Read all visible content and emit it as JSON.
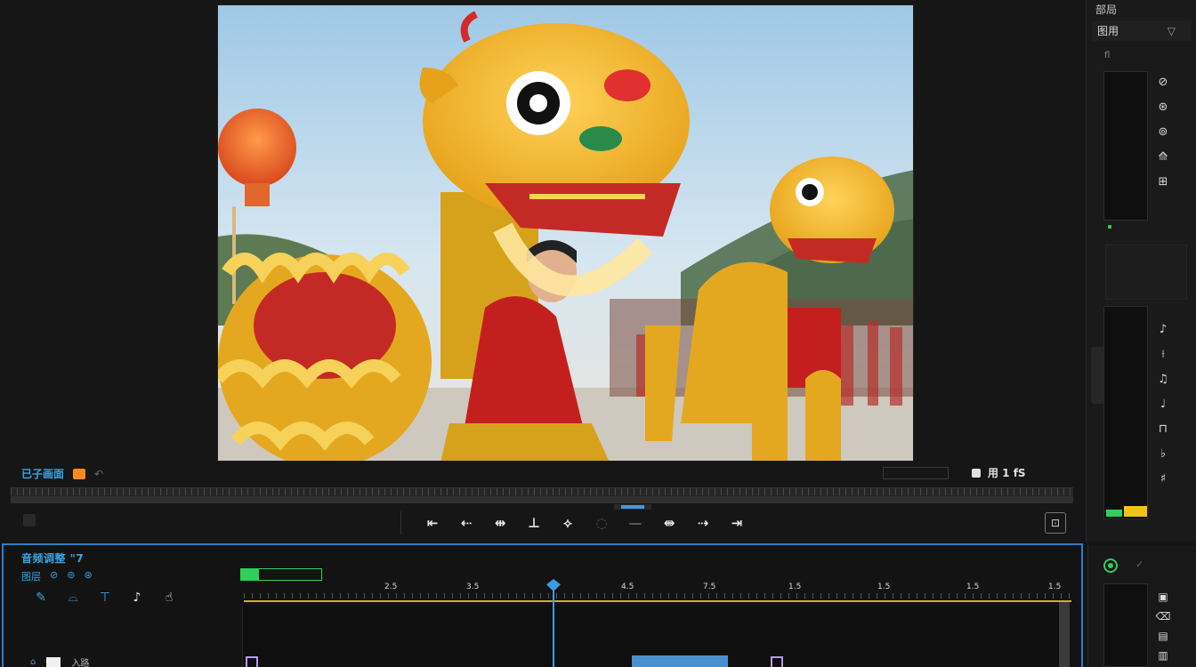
{
  "viewer": {
    "status_label": "已子画面",
    "small_glyph": "↶",
    "right_box_label": "",
    "resolution_label": "用 1 fS"
  },
  "transport": {
    "buttons": [
      {
        "id": "prev",
        "glyph": "⇤",
        "dim": false
      },
      {
        "id": "step-back",
        "glyph": "⇠",
        "dim": false
      },
      {
        "id": "mark-in",
        "glyph": "⇹",
        "dim": false
      },
      {
        "id": "trim",
        "glyph": "⊥",
        "dim": false
      },
      {
        "id": "split",
        "glyph": "⟡",
        "dim": false
      },
      {
        "id": "loop",
        "glyph": "◌",
        "dim": true
      },
      {
        "id": "gap",
        "glyph": "—",
        "dim": true
      },
      {
        "id": "mark-out",
        "glyph": "⇼",
        "dim": false
      },
      {
        "id": "step-fwd",
        "glyph": "⇢",
        "dim": false
      },
      {
        "id": "next",
        "glyph": "⇥",
        "dim": false
      }
    ],
    "fullscreen_glyph": "⊡"
  },
  "right_panel": {
    "title": "部局",
    "dropdown_label": "图用",
    "dropdown_chevron": "▽",
    "sub_label": "fl",
    "meter1_caption": "",
    "meter2_caption": "",
    "tools_top": [
      "⊘",
      "⊛",
      "⊚",
      "⟰",
      "⊞"
    ],
    "tools_bottom": [
      "♪",
      "⟊",
      "♫",
      "♩",
      "⊓",
      "♭",
      "♯"
    ],
    "colors": {
      "led": "#2ecf5a",
      "level_green": "#2ecf5a",
      "level_yellow": "#f2c41a"
    }
  },
  "timeline": {
    "title": "音频调整 \"7",
    "sub_label": "图层",
    "sub_icons": [
      "⊘",
      "⊚",
      "⊛"
    ],
    "icons": [
      {
        "name": "brush-icon",
        "glyph": "✎",
        "white": false
      },
      {
        "name": "shoe-icon",
        "glyph": "⌓",
        "white": false
      },
      {
        "name": "shirt-icon",
        "glyph": "⊤",
        "white": false
      },
      {
        "name": "note-icon",
        "glyph": "♪",
        "white": true
      },
      {
        "name": "hand-icon",
        "glyph": "☝",
        "white": true
      }
    ],
    "timecode": "",
    "ruler_labels": [
      "",
      "2.5",
      "3.5",
      "",
      "4.5",
      "7.5",
      "1.5",
      "1.5",
      "1.5",
      "1.5"
    ],
    "track_head_label": "入路",
    "track_head_tail": "",
    "blue_clip_label": "",
    "colors": {
      "accent": "#3aa3e0",
      "playhead": "#3d9be0",
      "clip_border": "#b89ae8",
      "ruler_line": "#c8b22a"
    }
  }
}
